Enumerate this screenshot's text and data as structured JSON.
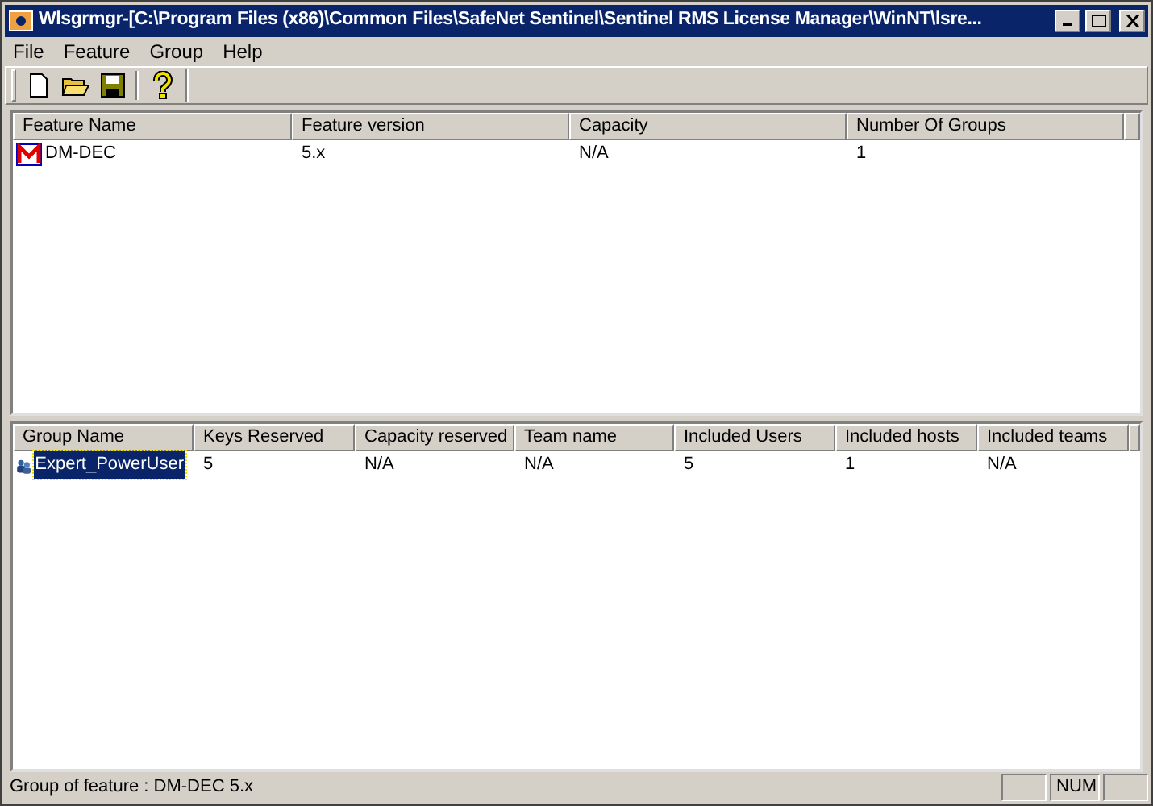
{
  "window": {
    "title": "Wlsgrmgr-[C:\\Program Files (x86)\\Common Files\\SafeNet Sentinel\\Sentinel RMS License Manager\\WinNT\\lsre..."
  },
  "menu": [
    "File",
    "Feature",
    "Group",
    "Help"
  ],
  "toolbar": [
    {
      "kind": "new"
    },
    {
      "kind": "open"
    },
    {
      "kind": "save"
    },
    {
      "kind": "sep"
    },
    {
      "kind": "help"
    }
  ],
  "features": {
    "columns": [
      "Feature Name",
      "Feature version",
      "Capacity",
      "Number Of Groups"
    ],
    "rows": [
      {
        "selected": false,
        "cells": [
          "DM-DEC",
          "5.x",
          "N/A",
          "1"
        ]
      }
    ]
  },
  "groups": {
    "columns": [
      "Group Name",
      "Keys Reserved",
      "Capacity reserved",
      "Team name",
      "Included Users",
      "Included hosts",
      "Included teams"
    ],
    "rows": [
      {
        "selected": true,
        "cells": [
          "Expert_PowerUser",
          "5",
          "N/A",
          "N/A",
          "5",
          "1",
          "N/A"
        ]
      }
    ]
  },
  "status_bar": {
    "text": "Group of feature : DM-DEC 5.x",
    "indicator": "NUM"
  }
}
